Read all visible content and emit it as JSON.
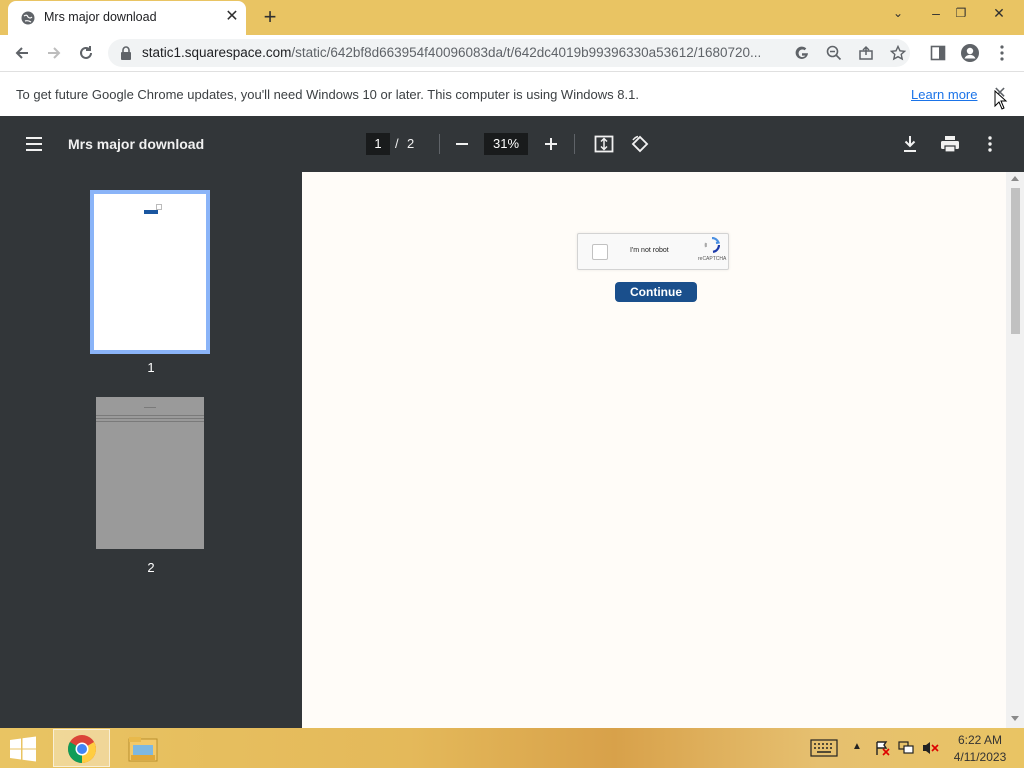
{
  "browser": {
    "tab_title": "Mrs major download",
    "url_host": "static1.squarespace.com",
    "url_path": "/static/642bf8d663954f40096083da/t/642dc4019b99396330a53612/1680720..."
  },
  "infobar": {
    "message": "To get future Google Chrome updates, you'll need Windows 10 or later. This computer is using Windows 8.1.",
    "link": "Learn more"
  },
  "pdf": {
    "title": "Mrs major download",
    "current_page": "1",
    "separator": "/",
    "total_pages": "2",
    "zoom": "31%",
    "thumbnails": [
      {
        "label": "1"
      },
      {
        "label": "2"
      }
    ]
  },
  "document": {
    "captcha_label": "I'm not robot",
    "captcha_brand": "reCAPTCHA",
    "continue_label": "Continue"
  },
  "taskbar": {
    "time": "6:22 AM",
    "date": "4/11/2023"
  },
  "colors": {
    "chrome_frame": "#e9c463",
    "pdf_toolbar": "#323639",
    "continue_button": "#1a4f8c",
    "thumbnail_selected": "#8ab4f8"
  }
}
